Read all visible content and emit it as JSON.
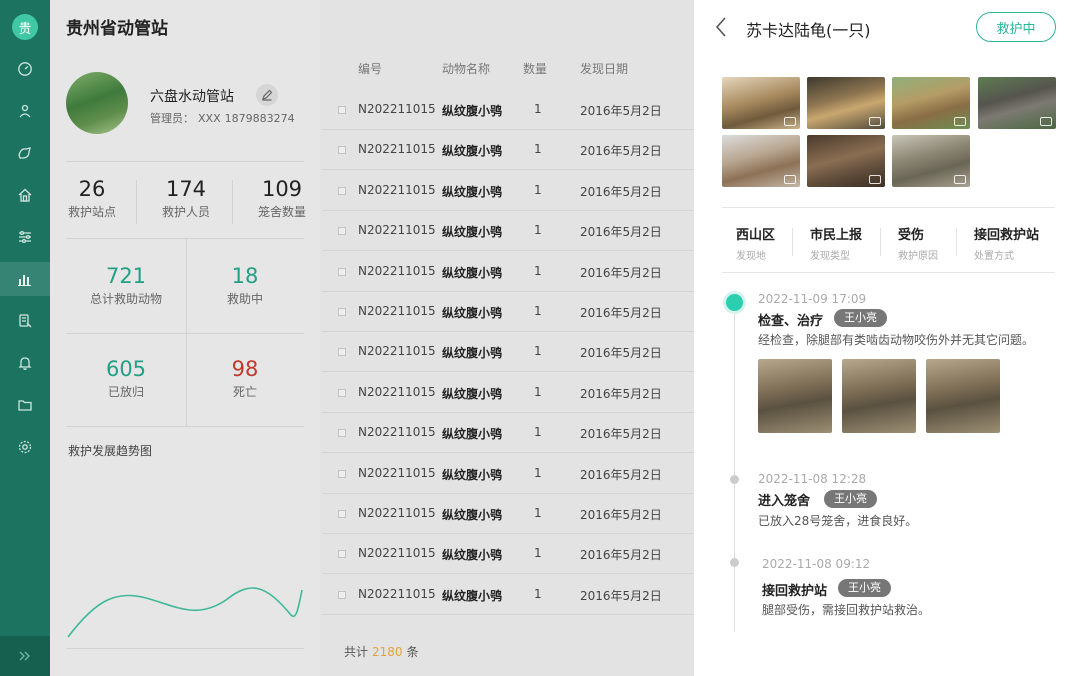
{
  "app": {
    "logo_char": "贵",
    "title": "贵州省动管站"
  },
  "sidebar": {
    "items": [
      "dashboard",
      "rescue",
      "animals",
      "station",
      "settings",
      "statistics",
      "records",
      "notifications",
      "files",
      "configuration"
    ]
  },
  "station": {
    "name": "六盘水动管站",
    "manager_label": "管理员：",
    "manager_name": "XXX",
    "manager_phone": "1879883274"
  },
  "stats_top": [
    {
      "value": "26",
      "label": "救护站点"
    },
    {
      "value": "174",
      "label": "救护人员"
    },
    {
      "value": "109",
      "label": "笼舍数量"
    }
  ],
  "stats_grid": [
    {
      "value": "721",
      "label": "总计救助动物"
    },
    {
      "value": "18",
      "label": "救助中"
    },
    {
      "value": "605",
      "label": "已放归"
    },
    {
      "value": "98",
      "label": "死亡"
    }
  ],
  "trend": {
    "title": "救护发展趋势图"
  },
  "table": {
    "headers": [
      "编号",
      "动物名称",
      "数量",
      "发现日期"
    ],
    "rows": [
      [
        "N202211015",
        "纵纹腹小鸮",
        "1",
        "2016年5月2日"
      ],
      [
        "N202211015",
        "纵纹腹小鸮",
        "1",
        "2016年5月2日"
      ],
      [
        "N202211015",
        "纵纹腹小鸮",
        "1",
        "2016年5月2日"
      ],
      [
        "N202211015",
        "纵纹腹小鸮",
        "1",
        "2016年5月2日"
      ],
      [
        "N202211015",
        "纵纹腹小鸮",
        "1",
        "2016年5月2日"
      ],
      [
        "N202211015",
        "纵纹腹小鸮",
        "1",
        "2016年5月2日"
      ],
      [
        "N202211015",
        "纵纹腹小鸮",
        "1",
        "2016年5月2日"
      ],
      [
        "N202211015",
        "纵纹腹小鸮",
        "1",
        "2016年5月2日"
      ],
      [
        "N202211015",
        "纵纹腹小鸮",
        "1",
        "2016年5月2日"
      ],
      [
        "N202211015",
        "纵纹腹小鸮",
        "1",
        "2016年5月2日"
      ],
      [
        "N202211015",
        "纵纹腹小鸮",
        "1",
        "2016年5月2日"
      ],
      [
        "N202211015",
        "纵纹腹小鸮",
        "1",
        "2016年5月2日"
      ],
      [
        "N202211015",
        "纵纹腹小鸮",
        "1",
        "2016年5月2日"
      ]
    ],
    "total_prefix": "共计",
    "total_count": "2180",
    "total_suffix": "条"
  },
  "detail": {
    "title": "苏卡达陆龟(一只)",
    "status": "救护中",
    "info": [
      {
        "value": "西山区",
        "key": "发现地"
      },
      {
        "value": "市民上报",
        "key": "发现类型"
      },
      {
        "value": "受伤",
        "key": "救护原因"
      },
      {
        "value": "接回救护站",
        "key": "处置方式"
      }
    ],
    "timeline": [
      {
        "time": "2022-11-09 17:09",
        "event": "检查、治疗",
        "person": "王小亮",
        "desc": "经检查，除腿部有类啮齿动物咬伤外并无其它问题。"
      },
      {
        "time": "2022-11-08 12:28",
        "event": "进入笼舍",
        "person": "王小亮",
        "desc": "已放入28号笼舍，进食良好。"
      },
      {
        "time": "2022-11-08 09:12",
        "event": "接回救护站",
        "person": "王小亮",
        "desc": "腿部受伤，需接回救护站救治。"
      }
    ]
  },
  "colors": {
    "sidebar": "#1b7360",
    "accent": "#2bb59a",
    "teal_text": "#22a085",
    "danger": "#c0392b",
    "count": "#e6a23c"
  }
}
